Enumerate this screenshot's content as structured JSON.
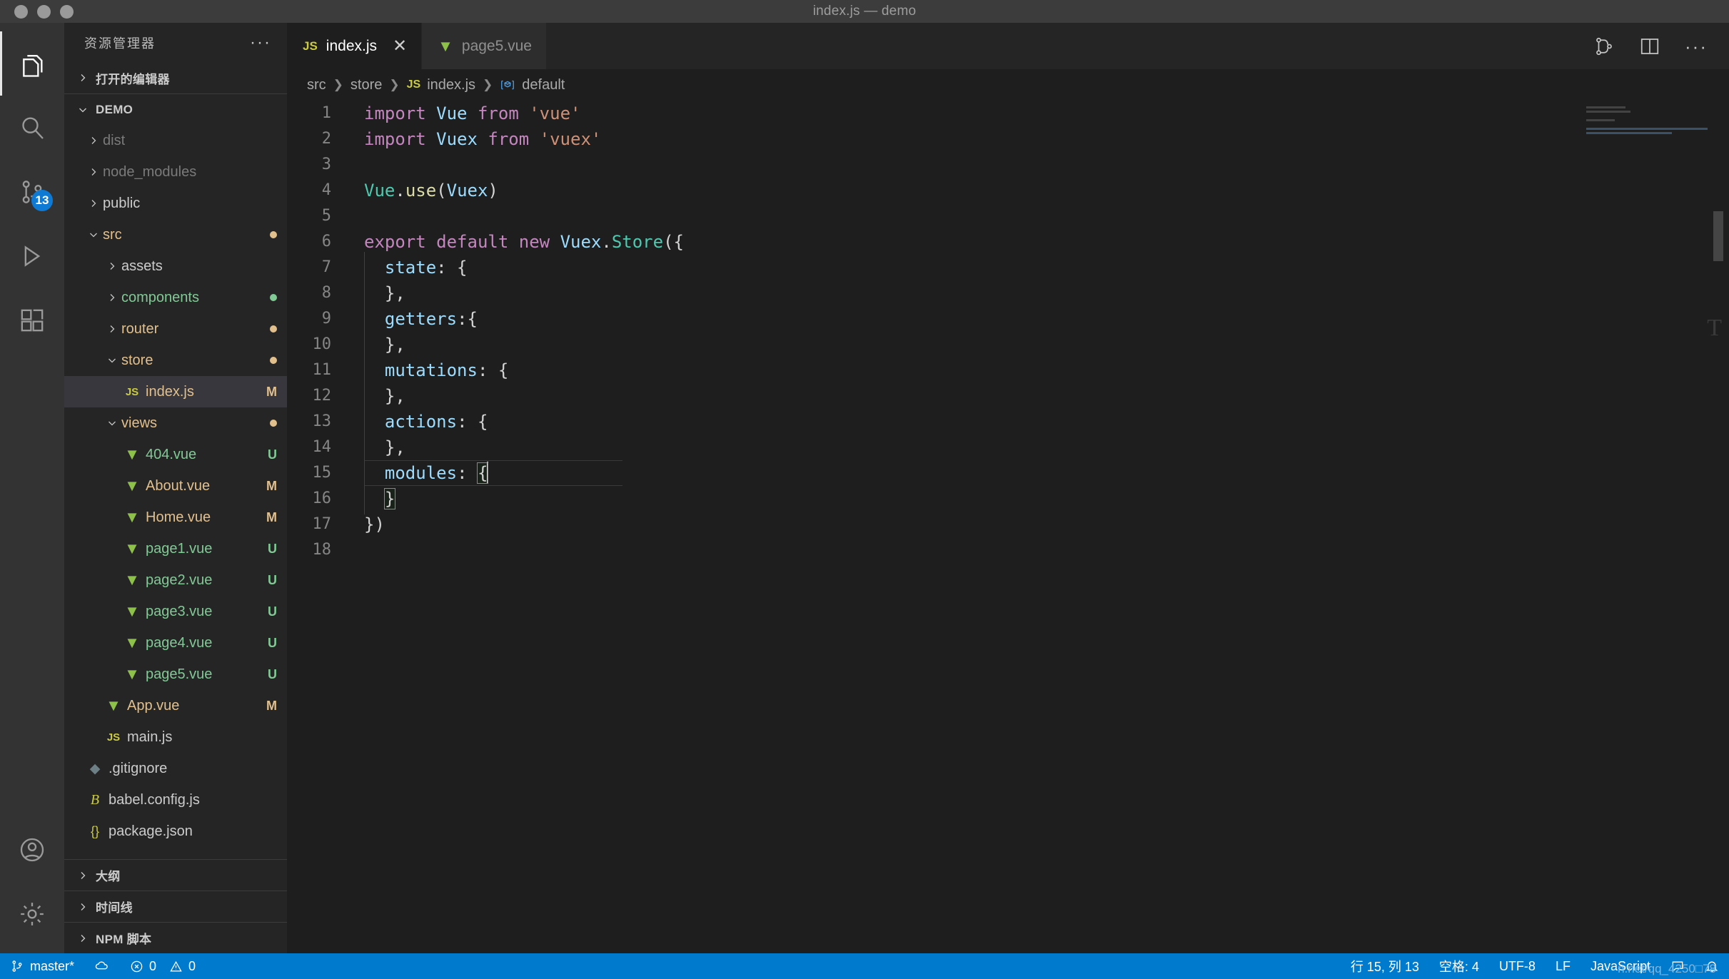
{
  "window": {
    "title": "index.js — demo"
  },
  "activitybar": {
    "items": [
      {
        "name": "explorer",
        "icon": "files-icon",
        "active": true,
        "badge": ""
      },
      {
        "name": "search",
        "icon": "search-icon",
        "active": false,
        "badge": ""
      },
      {
        "name": "source-control",
        "icon": "source-control-icon",
        "active": false,
        "badge": "13"
      },
      {
        "name": "run-and-debug",
        "icon": "debug-icon",
        "active": false,
        "badge": ""
      },
      {
        "name": "extensions",
        "icon": "extensions-icon",
        "active": false,
        "badge": ""
      }
    ],
    "bottom": [
      {
        "name": "accounts",
        "icon": "account-icon"
      },
      {
        "name": "manage",
        "icon": "gear-icon"
      }
    ]
  },
  "sidebar": {
    "title": "资源管理器",
    "more_label": "···",
    "sections": {
      "open_editors": "打开的编辑器",
      "project": "DEMO",
      "outline": "大纲",
      "timeline": "时间线",
      "npm_scripts": "NPM 脚本"
    },
    "tree": [
      {
        "label": "dist",
        "depth": 1,
        "type": "folder",
        "expanded": false,
        "color": "dim",
        "badge": "",
        "dot": ""
      },
      {
        "label": "node_modules",
        "depth": 1,
        "type": "folder",
        "expanded": false,
        "color": "dim",
        "badge": "",
        "dot": ""
      },
      {
        "label": "public",
        "depth": 1,
        "type": "folder",
        "expanded": false,
        "color": "default",
        "badge": "",
        "dot": ""
      },
      {
        "label": "src",
        "depth": 1,
        "type": "folder",
        "expanded": true,
        "color": "mod",
        "badge": "",
        "dot": "#e2c08d"
      },
      {
        "label": "assets",
        "depth": 2,
        "type": "folder",
        "expanded": false,
        "color": "default",
        "badge": "",
        "dot": ""
      },
      {
        "label": "components",
        "depth": 2,
        "type": "folder",
        "expanded": false,
        "color": "unt",
        "badge": "",
        "dot": "#81c995"
      },
      {
        "label": "router",
        "depth": 2,
        "type": "folder",
        "expanded": false,
        "color": "mod",
        "badge": "",
        "dot": "#e2c08d"
      },
      {
        "label": "store",
        "depth": 2,
        "type": "folder",
        "expanded": true,
        "color": "mod",
        "badge": "",
        "dot": "#e2c08d"
      },
      {
        "label": "index.js",
        "depth": 3,
        "type": "js",
        "expanded": null,
        "color": "mod",
        "badge": "M",
        "dot": "",
        "selected": true
      },
      {
        "label": "views",
        "depth": 2,
        "type": "folder",
        "expanded": true,
        "color": "mod",
        "badge": "",
        "dot": "#e2c08d"
      },
      {
        "label": "404.vue",
        "depth": 3,
        "type": "vue",
        "expanded": null,
        "color": "unt",
        "badge": "U",
        "dot": ""
      },
      {
        "label": "About.vue",
        "depth": 3,
        "type": "vue",
        "expanded": null,
        "color": "mod",
        "badge": "M",
        "dot": ""
      },
      {
        "label": "Home.vue",
        "depth": 3,
        "type": "vue",
        "expanded": null,
        "color": "mod",
        "badge": "M",
        "dot": ""
      },
      {
        "label": "page1.vue",
        "depth": 3,
        "type": "vue",
        "expanded": null,
        "color": "unt",
        "badge": "U",
        "dot": ""
      },
      {
        "label": "page2.vue",
        "depth": 3,
        "type": "vue",
        "expanded": null,
        "color": "unt",
        "badge": "U",
        "dot": ""
      },
      {
        "label": "page3.vue",
        "depth": 3,
        "type": "vue",
        "expanded": null,
        "color": "unt",
        "badge": "U",
        "dot": ""
      },
      {
        "label": "page4.vue",
        "depth": 3,
        "type": "vue",
        "expanded": null,
        "color": "unt",
        "badge": "U",
        "dot": ""
      },
      {
        "label": "page5.vue",
        "depth": 3,
        "type": "vue",
        "expanded": null,
        "color": "unt",
        "badge": "U",
        "dot": ""
      },
      {
        "label": "App.vue",
        "depth": 2,
        "type": "vue",
        "expanded": null,
        "color": "mod",
        "badge": "M",
        "dot": ""
      },
      {
        "label": "main.js",
        "depth": 2,
        "type": "js",
        "expanded": null,
        "color": "default",
        "badge": "",
        "dot": ""
      },
      {
        "label": ".gitignore",
        "depth": 1,
        "type": "git",
        "expanded": null,
        "color": "default",
        "badge": "",
        "dot": ""
      },
      {
        "label": "babel.config.js",
        "depth": 1,
        "type": "babel",
        "expanded": null,
        "color": "default",
        "badge": "",
        "dot": ""
      },
      {
        "label": "package.json",
        "depth": 1,
        "type": "json",
        "expanded": null,
        "color": "default",
        "badge": "",
        "dot": ""
      }
    ]
  },
  "tabs": [
    {
      "label": "index.js",
      "icon": "js-file-icon",
      "active": true,
      "closable": true,
      "close_glyph": "✕"
    },
    {
      "label": "page5.vue",
      "icon": "vue-file-icon",
      "active": false,
      "closable": false,
      "close_glyph": ""
    }
  ],
  "tab_actions": [
    {
      "name": "split-editor-merge-icon"
    },
    {
      "name": "split-editor-icon"
    },
    {
      "name": "more-actions-icon",
      "glyph": "···"
    }
  ],
  "breadcrumb": [
    {
      "label": "src",
      "icon": ""
    },
    {
      "label": "store",
      "icon": ""
    },
    {
      "label": "index.js",
      "icon": "js-file-icon"
    },
    {
      "label": "default",
      "icon": "symbol-object-icon"
    }
  ],
  "editor": {
    "language": "JavaScript",
    "lines": [
      {
        "n": 1,
        "git": "",
        "current": false,
        "indent": 0,
        "tokens": [
          {
            "t": "import",
            "c": "kw"
          },
          {
            "t": " ",
            "c": "plain"
          },
          {
            "t": "Vue",
            "c": "id"
          },
          {
            "t": " ",
            "c": "plain"
          },
          {
            "t": "from",
            "c": "kw"
          },
          {
            "t": " ",
            "c": "plain"
          },
          {
            "t": "'vue'",
            "c": "str"
          }
        ]
      },
      {
        "n": 2,
        "git": "",
        "current": false,
        "indent": 0,
        "tokens": [
          {
            "t": "import",
            "c": "kw"
          },
          {
            "t": " ",
            "c": "plain"
          },
          {
            "t": "Vuex",
            "c": "id"
          },
          {
            "t": " ",
            "c": "plain"
          },
          {
            "t": "from",
            "c": "kw"
          },
          {
            "t": " ",
            "c": "plain"
          },
          {
            "t": "'vuex'",
            "c": "str"
          }
        ]
      },
      {
        "n": 3,
        "git": "",
        "current": false,
        "indent": 0,
        "tokens": []
      },
      {
        "n": 4,
        "git": "",
        "current": false,
        "indent": 0,
        "tokens": [
          {
            "t": "Vue",
            "c": "cls"
          },
          {
            "t": ".",
            "c": "plain"
          },
          {
            "t": "use",
            "c": "fn"
          },
          {
            "t": "(",
            "c": "brkt"
          },
          {
            "t": "Vuex",
            "c": "id"
          },
          {
            "t": ")",
            "c": "brkt"
          }
        ]
      },
      {
        "n": 5,
        "git": "",
        "current": false,
        "indent": 0,
        "tokens": []
      },
      {
        "n": 6,
        "git": "",
        "current": false,
        "indent": 0,
        "tokens": [
          {
            "t": "export",
            "c": "kw"
          },
          {
            "t": " ",
            "c": "plain"
          },
          {
            "t": "default",
            "c": "kw"
          },
          {
            "t": " ",
            "c": "plain"
          },
          {
            "t": "new",
            "c": "kw"
          },
          {
            "t": " ",
            "c": "plain"
          },
          {
            "t": "Vuex",
            "c": "id"
          },
          {
            "t": ".",
            "c": "plain"
          },
          {
            "t": "Store",
            "c": "cls"
          },
          {
            "t": "({",
            "c": "brkt"
          }
        ]
      },
      {
        "n": 7,
        "git": "",
        "current": false,
        "indent": 1,
        "tokens": [
          {
            "t": "  ",
            "c": "plain"
          },
          {
            "t": "state",
            "c": "prop"
          },
          {
            "t": ": {",
            "c": "brkt"
          }
        ]
      },
      {
        "n": 8,
        "git": "",
        "current": false,
        "indent": 1,
        "tokens": [
          {
            "t": "  },",
            "c": "brkt"
          }
        ]
      },
      {
        "n": 9,
        "git": "added",
        "current": false,
        "indent": 1,
        "tokens": [
          {
            "t": "  ",
            "c": "plain"
          },
          {
            "t": "getters",
            "c": "prop"
          },
          {
            "t": ":{",
            "c": "brkt"
          }
        ]
      },
      {
        "n": 10,
        "git": "added",
        "current": false,
        "indent": 1,
        "tokens": [
          {
            "t": "  },",
            "c": "brkt"
          }
        ]
      },
      {
        "n": 11,
        "git": "",
        "current": false,
        "indent": 1,
        "tokens": [
          {
            "t": "  ",
            "c": "plain"
          },
          {
            "t": "mutations",
            "c": "prop"
          },
          {
            "t": ": {",
            "c": "brkt"
          }
        ]
      },
      {
        "n": 12,
        "git": "",
        "current": false,
        "indent": 1,
        "tokens": [
          {
            "t": "  },",
            "c": "brkt"
          }
        ]
      },
      {
        "n": 13,
        "git": "",
        "current": false,
        "indent": 1,
        "tokens": [
          {
            "t": "  ",
            "c": "plain"
          },
          {
            "t": "actions",
            "c": "prop"
          },
          {
            "t": ": {",
            "c": "brkt"
          }
        ]
      },
      {
        "n": 14,
        "git": "",
        "current": false,
        "indent": 1,
        "tokens": [
          {
            "t": "  },",
            "c": "brkt"
          }
        ]
      },
      {
        "n": 15,
        "git": "",
        "current": true,
        "indent": 1,
        "tokens": [
          {
            "t": "  ",
            "c": "plain"
          },
          {
            "t": "modules",
            "c": "prop"
          },
          {
            "t": ": ",
            "c": "brkt"
          },
          {
            "t": "{",
            "c": "brkt match"
          },
          {
            "t": "|cursor|",
            "c": "cursor"
          }
        ]
      },
      {
        "n": 16,
        "git": "",
        "current": false,
        "indent": 1,
        "tokens": [
          {
            "t": "  ",
            "c": "plain"
          },
          {
            "t": "}",
            "c": "brkt match"
          }
        ]
      },
      {
        "n": 17,
        "git": "",
        "current": false,
        "indent": 0,
        "tokens": [
          {
            "t": "})",
            "c": "brkt"
          }
        ]
      },
      {
        "n": 18,
        "git": "",
        "current": false,
        "indent": 0,
        "tokens": []
      }
    ]
  },
  "statusbar": {
    "branch": "master*",
    "branch_icon": "source-control-icon",
    "sync_icon": "cloud-sync-icon",
    "errors": "0",
    "warnings": "0",
    "error_icon": "error-icon",
    "warning_icon": "warning-icon",
    "cursor_position": "行 15, 列 13",
    "indentation": "空格: 4",
    "encoding": "UTF-8",
    "eol": "LF",
    "language": "JavaScript",
    "bell_icon": "bell-icon",
    "feedback_icon": "feedback-icon",
    "watermark": "n.net/qq_4250□78"
  }
}
